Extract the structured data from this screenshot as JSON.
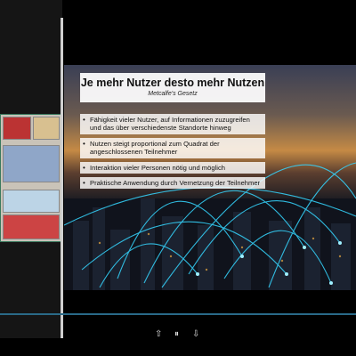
{
  "slide": {
    "title": "Je mehr Nutzer desto mehr Nutzen",
    "subtitle": "Metcalfe's Gesetz",
    "bullets": [
      "Fähigkeit vieler Nutzer, auf Informationen zuzugreifen und das über verschiedenste Standorte hinweg",
      "Nutzen steigt proportional zum Quadrat der angeschlossenen Teilnehmer",
      "Interaktion vieler Personen nötig und möglich",
      "Praktische Anwendung durch Vernetzung der Teilnehmer"
    ]
  },
  "controls": {
    "prev": "⇧",
    "pause": "⏸",
    "next": "⇩"
  },
  "colors": {
    "accent": "#2a6a88",
    "network_lines": "#35d6ff"
  }
}
